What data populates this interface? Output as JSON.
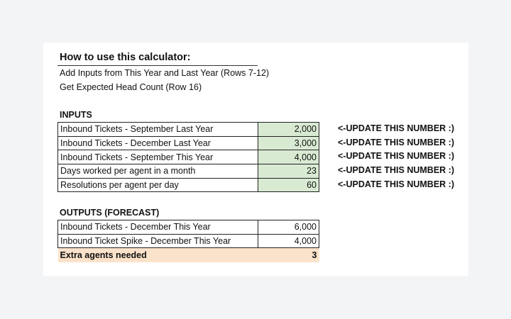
{
  "howto": {
    "title": "How to use this calculator:",
    "lines": [
      "Add Inputs from This Year and Last Year (Rows 7-12)",
      "Get Expected Head Count (Row 16)"
    ]
  },
  "inputs": {
    "title": "INPUTS",
    "rows": [
      {
        "label": "Inbound Tickets - September Last Year",
        "value": "2,000",
        "note": "<-UPDATE THIS NUMBER :)"
      },
      {
        "label": "Inbound Tickets - December Last Year",
        "value": "3,000",
        "note": "<-UPDATE THIS NUMBER :)"
      },
      {
        "label": "Inbound Tickets - September This Year",
        "value": "4,000",
        "note": "<-UPDATE THIS NUMBER :)"
      },
      {
        "label": "Days worked per agent in a month",
        "value": "23",
        "note": "<-UPDATE THIS NUMBER :)"
      },
      {
        "label": "Resolutions per agent per day",
        "value": "60",
        "note": "<-UPDATE THIS NUMBER :)"
      }
    ]
  },
  "outputs": {
    "title": "OUTPUTS (FORECAST)",
    "rows": [
      {
        "label": "Inbound Tickets - December This Year",
        "value": "6,000"
      },
      {
        "label": "Inbound Ticket Spike - December This Year",
        "value": "4,000"
      }
    ],
    "total": {
      "label": "Extra agents needed",
      "value": "3"
    }
  },
  "colors": {
    "input_fill": "#d9ead3",
    "total_fill": "#fbe2ca",
    "page_background": "#f3f4f6",
    "sheet_background": "#ffffff"
  }
}
